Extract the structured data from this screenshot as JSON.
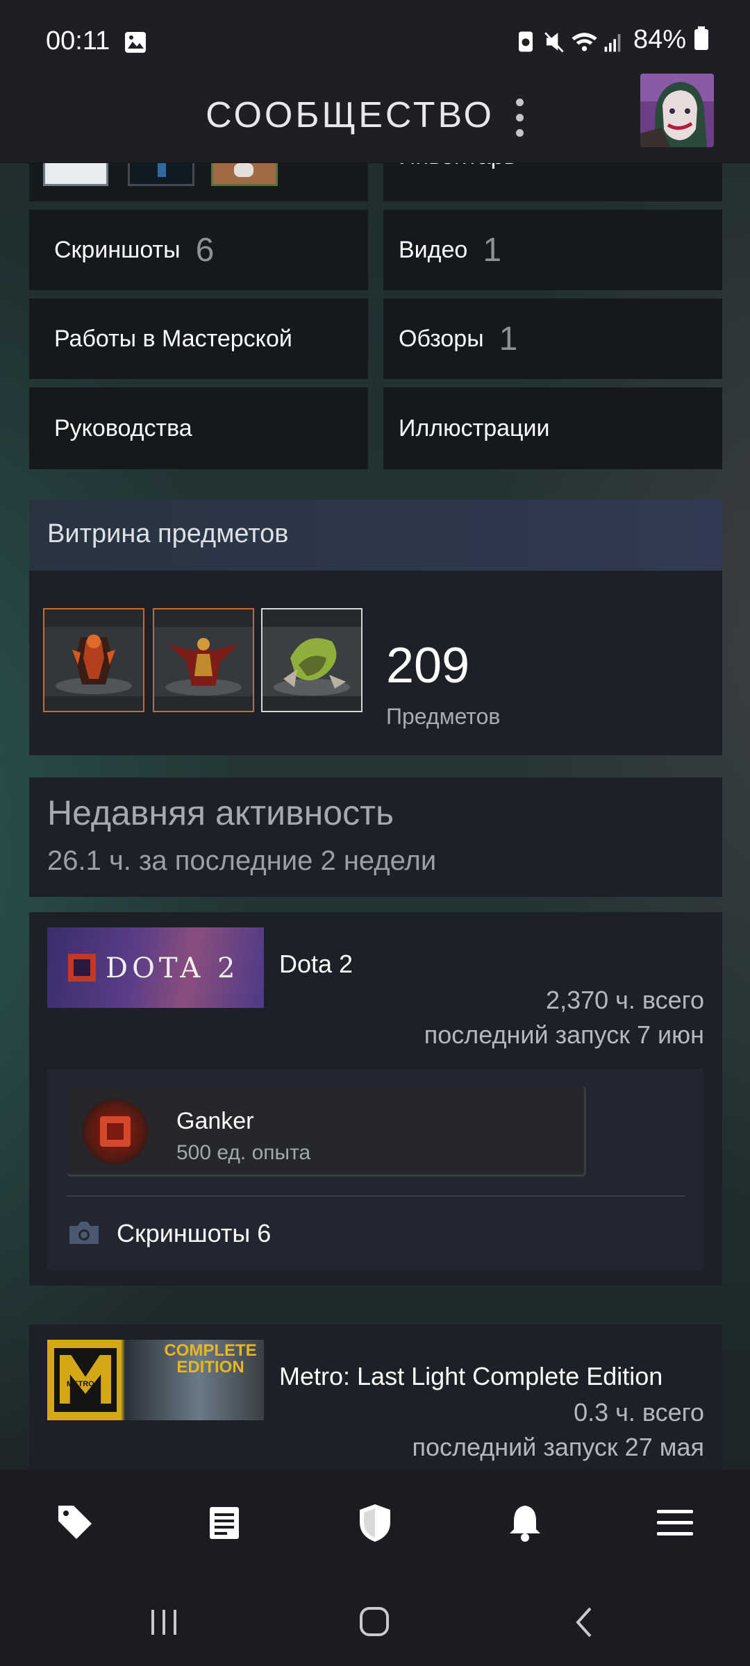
{
  "status_bar": {
    "time": "00:11",
    "battery": "84%"
  },
  "header": {
    "title": "СООБЩЕСТВО"
  },
  "profile_links": [
    {
      "label": "Инвентарь",
      "count": ""
    },
    {
      "label": "Скриншоты",
      "count": "6"
    },
    {
      "label": "Видео",
      "count": "1"
    },
    {
      "label": "Работы в Мастерской",
      "count": ""
    },
    {
      "label": "Обзоры",
      "count": "1"
    },
    {
      "label": "Руководства",
      "count": ""
    },
    {
      "label": "Иллюстрации",
      "count": ""
    }
  ],
  "item_showcase": {
    "title": "Витрина предметов",
    "count": "209",
    "count_label": "Предметов"
  },
  "recent_activity": {
    "title": "Недавняя активность",
    "subtitle": "26.1 ч. за последние 2 недели"
  },
  "games": [
    {
      "banner_text": "DOTA 2",
      "name": "Dota 2",
      "total": "2,370 ч. всего",
      "last_played": "последний запуск 7 июн",
      "achievement": {
        "name": "Ganker",
        "xp": "500 ед. опыта"
      },
      "screenshots": "Скриншоты 6"
    },
    {
      "banner_text": "METRO",
      "banner_badge": "COMPLETE EDITION",
      "name": "Metro: Last Light Complete Edition",
      "total": "0.3 ч. всего",
      "last_played": "последний запуск 27 мая"
    }
  ],
  "bottom_nav": [
    {
      "icon": "tag-icon"
    },
    {
      "icon": "news-icon"
    },
    {
      "icon": "shield-icon"
    },
    {
      "icon": "bell-icon"
    },
    {
      "icon": "hamburger-icon"
    }
  ],
  "colors": {
    "background": "#1b1c21",
    "tile": "#16191c",
    "accent_orange": "#c96a2f"
  }
}
